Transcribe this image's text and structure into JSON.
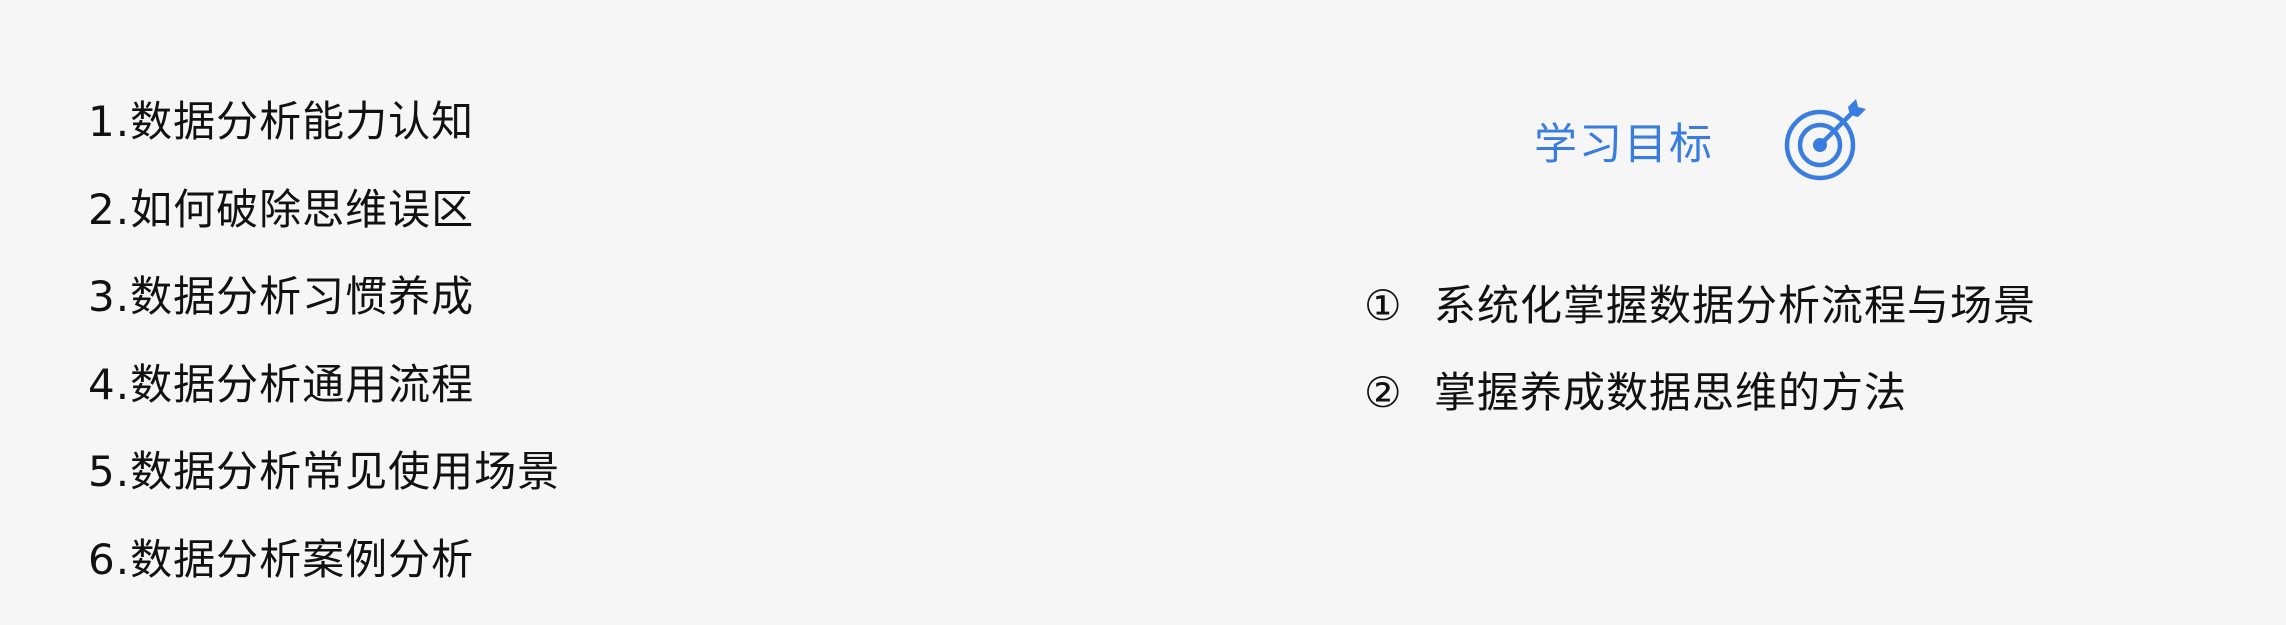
{
  "agenda": {
    "items": [
      "1.数据分析能力认知",
      "2.如何破除思维误区",
      "3.数据分析习惯养成",
      "4.数据分析通用流程",
      "5.数据分析常见使用场景",
      "6.数据分析案例分析"
    ]
  },
  "goals": {
    "title": "学习目标",
    "icon": "target-icon",
    "accent_color": "#3a7de0",
    "items": [
      {
        "num": "①",
        "text": "系统化掌握数据分析流程与场景"
      },
      {
        "num": "②",
        "text": "掌握养成数据思维的方法"
      }
    ]
  }
}
